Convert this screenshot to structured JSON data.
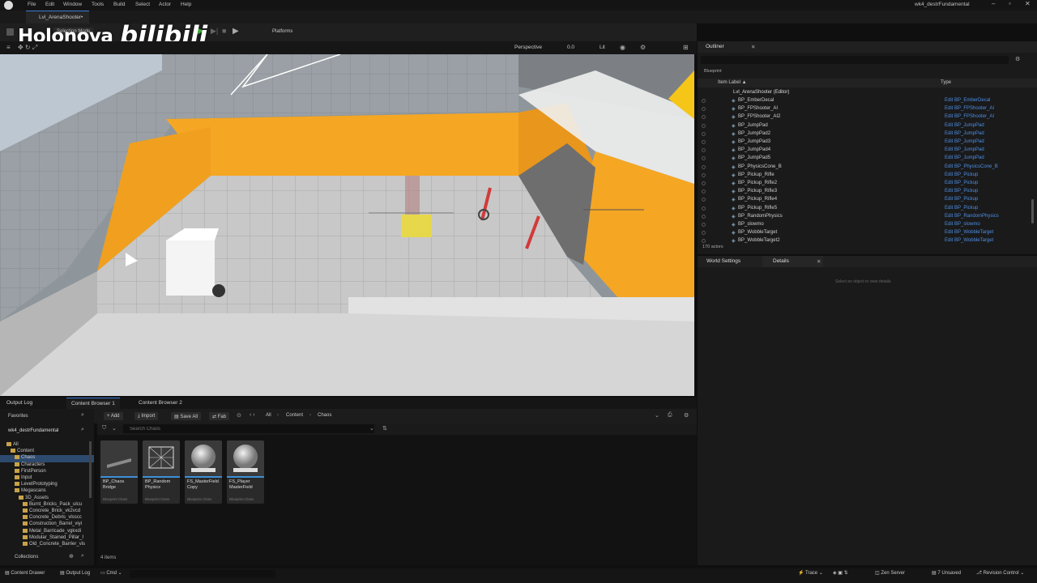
{
  "menubar": {
    "items": [
      "File",
      "Edit",
      "Window",
      "Tools",
      "Build",
      "Select",
      "Actor",
      "Help"
    ],
    "project_title": "wk4_destrFundamental"
  },
  "level_tab": {
    "label": "Lvl_ArenaShooter•"
  },
  "toolbar": {
    "selection_mode": "Selection Mode",
    "platforms": "Platforms"
  },
  "viewport_bar": {
    "perspective": "Perspective",
    "lit": "Lit",
    "speed": "0.0"
  },
  "watermark": {
    "left": "Holonova",
    "right": "bilibili"
  },
  "outliner": {
    "tab_label": "Outliner",
    "filter_label": "Blueprint",
    "col_item_label": "Item Label ▲",
    "col_type": "Type",
    "root_label": "Lvl_ArenaShooter (Editor)",
    "rows": [
      {
        "name": "BP_EmberDecal",
        "type": "Edit BP_EmberDecal"
      },
      {
        "name": "BP_FPShooter_AI",
        "type": "Edit BP_FPShooter_AI"
      },
      {
        "name": "BP_FPShooter_AI2",
        "type": "Edit BP_FPShooter_AI"
      },
      {
        "name": "BP_JumpPad",
        "type": "Edit BP_JumpPad"
      },
      {
        "name": "BP_JumpPad2",
        "type": "Edit BP_JumpPad"
      },
      {
        "name": "BP_JumpPad3",
        "type": "Edit BP_JumpPad"
      },
      {
        "name": "BP_JumpPad4",
        "type": "Edit BP_JumpPad"
      },
      {
        "name": "BP_JumpPad5",
        "type": "Edit BP_JumpPad"
      },
      {
        "name": "BP_PhysicsCone_B",
        "type": "Edit BP_PhysicsCone_B"
      },
      {
        "name": "BP_Pickup_Rifle",
        "type": "Edit BP_Pickup"
      },
      {
        "name": "BP_Pickup_Rifle2",
        "type": "Edit BP_Pickup"
      },
      {
        "name": "BP_Pickup_Rifle3",
        "type": "Edit BP_Pickup"
      },
      {
        "name": "BP_Pickup_Rifle4",
        "type": "Edit BP_Pickup"
      },
      {
        "name": "BP_Pickup_Rifle5",
        "type": "Edit BP_Pickup"
      },
      {
        "name": "BP_RandomPhysics",
        "type": "Edit BP_RandomPhysics"
      },
      {
        "name": "BP_slowmo",
        "type": "Edit BP_slowmo"
      },
      {
        "name": "BP_WobbleTarget",
        "type": "Edit BP_WobbleTarget"
      },
      {
        "name": "BP_WobbleTarget2",
        "type": "Edit BP_WobbleTarget"
      }
    ],
    "actor_count": "170 actors"
  },
  "details": {
    "tab_world_settings": "World Settings",
    "tab_details": "Details",
    "empty_message": "Select an object to view details."
  },
  "bottom_tabs": {
    "output_log": "Output Log",
    "content_browser_1": "Content Browser 1",
    "content_browser_2": "Content Browser 2"
  },
  "content_browser": {
    "add": "Add",
    "import": "Import",
    "save_all": "Save All",
    "fab": "Fab",
    "breadcrumb": [
      "All",
      "Content",
      "Chaos"
    ],
    "search_placeholder": "Search Chaos",
    "favorites": "Favorites",
    "project_root": "wk4_destrFundamental",
    "tree": [
      {
        "label": "All",
        "indent": 0
      },
      {
        "label": "Content",
        "indent": 1
      },
      {
        "label": "Chaos",
        "indent": 2,
        "selected": true
      },
      {
        "label": "Characters",
        "indent": 2
      },
      {
        "label": "FirstPerson",
        "indent": 2
      },
      {
        "label": "Input",
        "indent": 2
      },
      {
        "label": "LevelPrototyping",
        "indent": 2
      },
      {
        "label": "Megascans",
        "indent": 2
      },
      {
        "label": "3D_Assets",
        "indent": 3
      },
      {
        "label": "Burnt_Bricks_Pack_ulcu",
        "indent": 4
      },
      {
        "label": "Concrete_Brick_vk2vcd",
        "indent": 4
      },
      {
        "label": "Concrete_Debris_vlsscc",
        "indent": 4
      },
      {
        "label": "Construction_Barrel_viyi",
        "indent": 4
      },
      {
        "label": "Metal_Barricade_vgkxdi",
        "indent": 4
      },
      {
        "label": "Modular_Stained_Pillar_I",
        "indent": 4
      },
      {
        "label": "Old_Concrete_Barrier_vis",
        "indent": 4
      }
    ],
    "collections": "Collections",
    "item_count": "4 items",
    "assets": [
      {
        "name": "BP_Chaos Bridge",
        "sub": "Blueprint Class",
        "bar": "#3d8fd6"
      },
      {
        "name": "BP_Random Physics",
        "sub": "Blueprint Class",
        "bar": "#3d8fd6"
      },
      {
        "name": "FS_MasterField Copy",
        "sub": "Blueprint Class",
        "bar": "#3d8fd6"
      },
      {
        "name": "FS_Player MasterField",
        "sub": "Blueprint Class",
        "bar": "#3d8fd6"
      }
    ]
  },
  "statusbar": {
    "content_drawer": "Content Drawer",
    "output_log": "Output Log",
    "cmd": "Cmd",
    "trace": "Trace",
    "zen_server": "Zen Server",
    "unsaved": "7 Unsaved",
    "revision_control": "Revision Control"
  },
  "colors": {
    "accent": "#3a7bd5",
    "link": "#4c8fe6",
    "wall_orange": "#f5a623",
    "floor": "#c9c9c9"
  }
}
